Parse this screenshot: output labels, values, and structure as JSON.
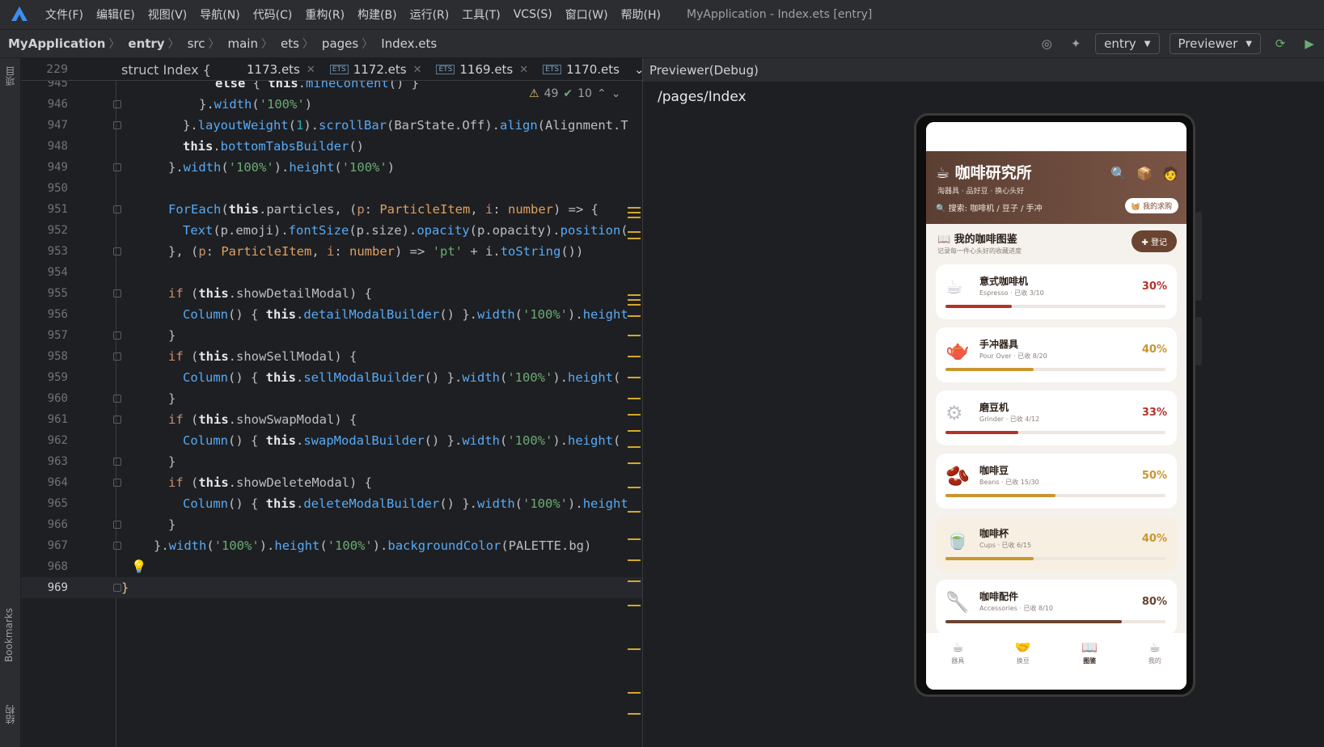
{
  "titlebar": {
    "menus": [
      "文件(F)",
      "编辑(E)",
      "视图(V)",
      "导航(N)",
      "代码(C)",
      "重构(R)",
      "构建(B)",
      "运行(R)",
      "工具(T)",
      "VCS(S)",
      "窗口(W)",
      "帮助(H)"
    ],
    "title": "MyApplication - Index.ets [entry]"
  },
  "breadcrumb": [
    "MyApplication",
    "entry",
    "src",
    "main",
    "ets",
    "pages",
    "Index.ets"
  ],
  "toolbar": {
    "module": "entry",
    "previewer": "Previewer"
  },
  "leftstrip": {
    "project": "项目",
    "bookmarks": "Bookmarks",
    "structure": "结构"
  },
  "editor": {
    "sticky_line": "229",
    "sticky_code": "struct Index {",
    "tabs": [
      "1173.ets",
      "1172.ets",
      "1169.ets",
      "1170.ets"
    ],
    "warnings": "49",
    "checks": "10",
    "lines": [
      "945",
      "946",
      "947",
      "948",
      "949",
      "950",
      "951",
      "952",
      "953",
      "954",
      "955",
      "956",
      "957",
      "958",
      "959",
      "960",
      "961",
      "962",
      "963",
      "964",
      "965",
      "966",
      "967",
      "968",
      "969"
    ]
  },
  "previewer": {
    "header": "Previewer(Debug)",
    "path": "/pages/Index"
  },
  "app": {
    "title": "咖啡研究所",
    "subtitle": "淘器具 · 品好豆 · 换心头好",
    "search": "搜索: 咖啡机 / 豆子 / 手冲",
    "ask": "我的求购",
    "section_title": "我的咖啡图鉴",
    "section_sub": "记录每一件心头好的收藏进度",
    "register": "登记",
    "cards": [
      {
        "name": "意式咖啡机",
        "meta": "Espresso · 已收 3/10",
        "pct": "30%",
        "fraction": 0.3,
        "color": "#b5322a",
        "icon": "☕"
      },
      {
        "name": "手冲器具",
        "meta": "Pour Over · 已收 8/20",
        "pct": "40%",
        "fraction": 0.4,
        "color": "#c9962e",
        "icon": "🫖"
      },
      {
        "name": "磨豆机",
        "meta": "Grinder · 已收 4/12",
        "pct": "33%",
        "fraction": 0.33,
        "color": "#b5322a",
        "icon": "⚙"
      },
      {
        "name": "咖啡豆",
        "meta": "Beans · 已收 15/30",
        "pct": "50%",
        "fraction": 0.5,
        "color": "#c9962e",
        "icon": "🫘"
      },
      {
        "name": "咖啡杯",
        "meta": "Cups · 已收 6/15",
        "pct": "40%",
        "fraction": 0.4,
        "color": "#c9962e",
        "icon": "🍵"
      },
      {
        "name": "咖啡配件",
        "meta": "Accessories · 已收 8/10",
        "pct": "80%",
        "fraction": 0.8,
        "color": "#6a4430",
        "icon": "🥄"
      }
    ],
    "nav": [
      {
        "label": "器具",
        "icon": "☕"
      },
      {
        "label": "换豆",
        "icon": "🤝"
      },
      {
        "label": "图鉴",
        "icon": "📖"
      },
      {
        "label": "我的",
        "icon": "☕"
      }
    ]
  }
}
